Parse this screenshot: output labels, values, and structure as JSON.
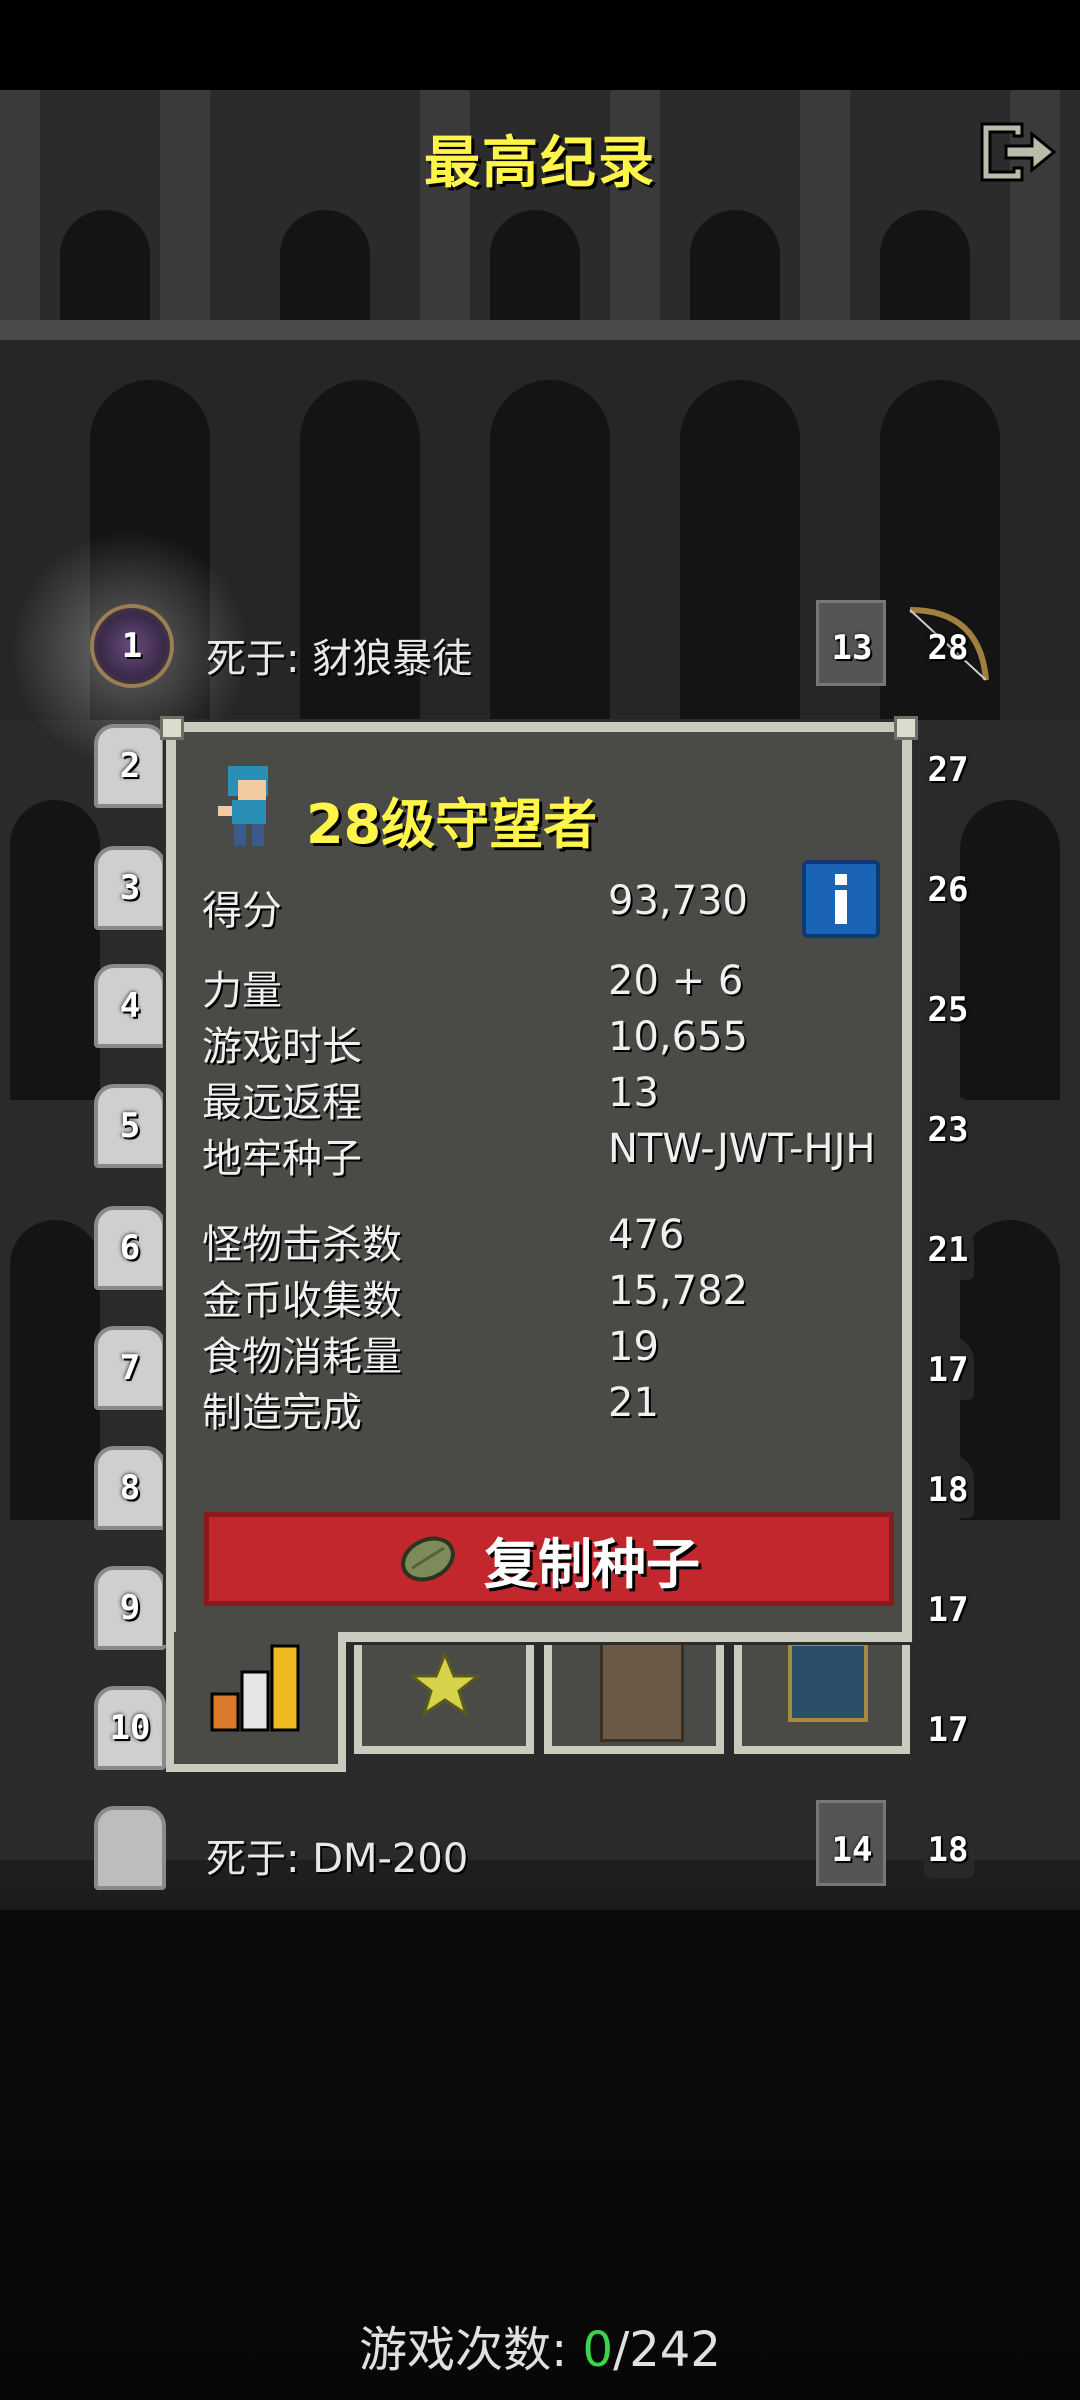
{
  "header": {
    "title": "最高纪录",
    "exit_icon": "exit-icon"
  },
  "records": {
    "top": {
      "rank": "1",
      "label": "死于:  豺狼暴徒",
      "depth": "13",
      "level": "28"
    },
    "ranks": [
      "2",
      "3",
      "4",
      "5",
      "6",
      "7",
      "8",
      "9",
      "10"
    ],
    "right_levels": [
      "27",
      "26",
      "25",
      "23",
      "21",
      "17",
      "18",
      "17",
      "17"
    ],
    "bottom": {
      "label": "死于:  DM-200",
      "depth": "14",
      "level": "18"
    }
  },
  "panel": {
    "hero_title": "28级守望者",
    "score_label": "得分",
    "score_value": "93,730",
    "stats": [
      {
        "label": "力量",
        "value": "20 + 6"
      },
      {
        "label": "游戏时长",
        "value": "10,655"
      },
      {
        "label": "最远返程",
        "value": "13"
      },
      {
        "label": "地牢种子",
        "value": "NTW-JWT-HJH"
      },
      {
        "label": "怪物击杀数",
        "value": "476"
      },
      {
        "label": "金币收集数",
        "value": "15,782"
      },
      {
        "label": "食物消耗量",
        "value": "19"
      },
      {
        "label": "制造完成",
        "value": "21"
      }
    ],
    "copy_seed_label": "复制种子",
    "tabs": [
      "stats-tab-icon",
      "badges-tab-icon",
      "items-tab-icon",
      "challenges-tab-icon"
    ]
  },
  "footer": {
    "label": "游戏次数:  ",
    "current": "0",
    "total": "/242"
  },
  "colors": {
    "title": "#fff44a",
    "copy_button": "#c1272d",
    "info_button": "#1a63b5",
    "current_count": "#3bd54b"
  }
}
